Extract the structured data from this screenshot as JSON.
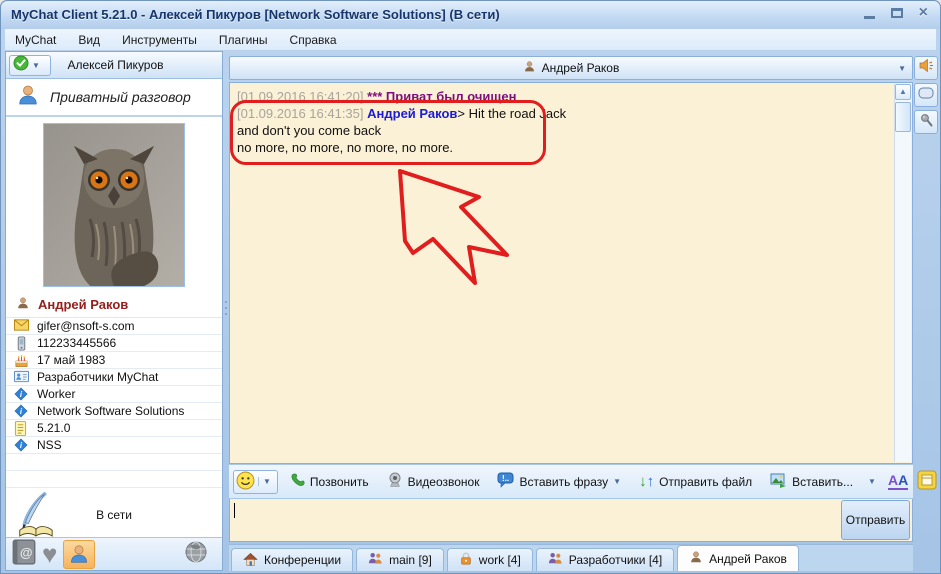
{
  "window": {
    "title": "MyChat Client 5.21.0 - Алексей Пикуров [Network Software Solutions] (В сети)"
  },
  "menu": {
    "items": [
      "MyChat",
      "Вид",
      "Инструменты",
      "Плагины",
      "Справка"
    ]
  },
  "sidebar": {
    "header_name": "Алексей Пикуров",
    "private_label": "Приватный разговор",
    "contact_name": "Андрей Раков",
    "details": [
      {
        "icon": "email-icon",
        "value": "gifer@nsoft-s.com"
      },
      {
        "icon": "phone-icon",
        "value": "112233445566"
      },
      {
        "icon": "birthday-icon",
        "value": "17 май 1983"
      },
      {
        "icon": "group-icon",
        "value": "Разработчики MyChat"
      },
      {
        "icon": "info-icon",
        "value": "Worker"
      },
      {
        "icon": "info-icon",
        "value": "Network Software Solutions"
      },
      {
        "icon": "version-icon",
        "value": "5.21.0"
      },
      {
        "icon": "info-icon",
        "value": "NSS"
      }
    ],
    "status_text": "В сети"
  },
  "chat": {
    "header_name": "Андрей Раков",
    "messages": [
      {
        "timestamp": "[01.09.2016 16:41:20]",
        "system_text": "*** Приват был очищен"
      },
      {
        "timestamp": "[01.09.2016 16:41:35]",
        "author": "Андрей Раков",
        "lines": [
          "> Hit the road Jack",
          "and don't you come back",
          "no more, no more, no more, no more."
        ]
      }
    ]
  },
  "toolbar": {
    "call": "Позвонить",
    "video": "Видеозвонок",
    "phrase": "Вставить фразу",
    "send_file": "Отправить файл",
    "insert": "Вставить...",
    "send": "Отправить"
  },
  "tabs": [
    {
      "icon": "home-icon",
      "label": "Конференции"
    },
    {
      "icon": "group-icon",
      "label": "main [9]"
    },
    {
      "icon": "lock-icon",
      "label": "work [4]"
    },
    {
      "icon": "group-icon",
      "label": "Разработчики [4]"
    },
    {
      "icon": "person-icon",
      "label": "Андрей Раков"
    }
  ],
  "colors": {
    "annotation_red": "#e11d1d",
    "chat_background": "#fbf1d6",
    "frame_blue": "#a5c4e6",
    "author_blue": "#1b1bd6",
    "system_purple": "#7d0f7d",
    "timestamp_gray": "#a8a49c",
    "contact_name_red": "#94201e"
  }
}
